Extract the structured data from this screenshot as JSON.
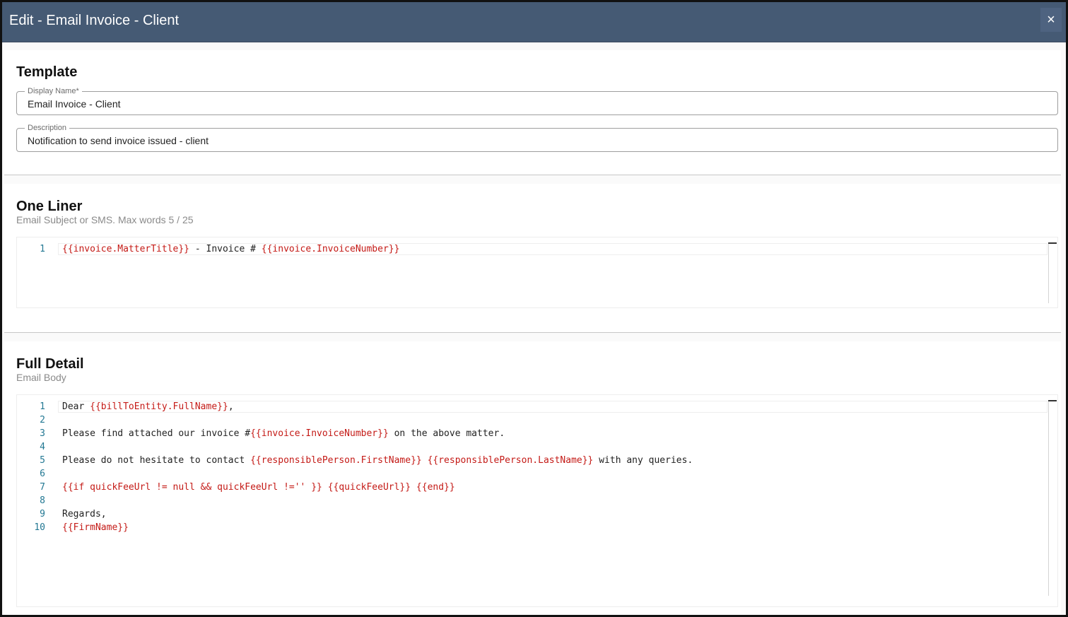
{
  "dialog": {
    "title": "Edit - Email Invoice - Client",
    "close_symbol": "×"
  },
  "template": {
    "heading": "Template",
    "display_name": {
      "label": "Display Name*",
      "value": "Email Invoice - Client"
    },
    "description": {
      "label": "Description",
      "value": "Notification to send invoice issued - client"
    }
  },
  "one_liner": {
    "heading": "One Liner",
    "subheading": "Email Subject or SMS. Max words 5 / 25",
    "lines": [
      {
        "num": "1",
        "tokens": [
          {
            "kind": "v",
            "text": "{{invoice.MatterTitle}}"
          },
          {
            "kind": "t",
            "text": " - Invoice # "
          },
          {
            "kind": "v",
            "text": "{{invoice.InvoiceNumber}}"
          }
        ]
      }
    ]
  },
  "full_detail": {
    "heading": "Full Detail",
    "subheading": "Email Body",
    "lines": [
      {
        "num": "1",
        "tokens": [
          {
            "kind": "t",
            "text": "Dear "
          },
          {
            "kind": "v",
            "text": "{{billToEntity.FullName}}"
          },
          {
            "kind": "t",
            "text": ","
          }
        ]
      },
      {
        "num": "2",
        "tokens": []
      },
      {
        "num": "3",
        "tokens": [
          {
            "kind": "t",
            "text": "Please find attached our invoice #"
          },
          {
            "kind": "v",
            "text": "{{invoice.InvoiceNumber}}"
          },
          {
            "kind": "t",
            "text": " on the above matter."
          }
        ]
      },
      {
        "num": "4",
        "tokens": []
      },
      {
        "num": "5",
        "tokens": [
          {
            "kind": "t",
            "text": "Please do not hesitate to contact "
          },
          {
            "kind": "v",
            "text": "{{responsiblePerson.FirstName}}"
          },
          {
            "kind": "t",
            "text": " "
          },
          {
            "kind": "v",
            "text": "{{responsiblePerson.LastName}}"
          },
          {
            "kind": "t",
            "text": " with any queries."
          }
        ]
      },
      {
        "num": "6",
        "tokens": []
      },
      {
        "num": "7",
        "tokens": [
          {
            "kind": "v",
            "text": "{{if quickFeeUrl != null && quickFeeUrl !='' }}"
          },
          {
            "kind": "t",
            "text": " "
          },
          {
            "kind": "v",
            "text": "{{quickFeeUrl}}"
          },
          {
            "kind": "t",
            "text": " "
          },
          {
            "kind": "v",
            "text": "{{end}}"
          }
        ]
      },
      {
        "num": "8",
        "tokens": []
      },
      {
        "num": "9",
        "tokens": [
          {
            "kind": "t",
            "text": "Regards,"
          }
        ]
      },
      {
        "num": "10",
        "tokens": [
          {
            "kind": "v",
            "text": "{{FirmName}}"
          }
        ]
      }
    ]
  },
  "colors": {
    "titlebar": "#455a74",
    "template_variable": "#c41a16",
    "line_number": "#237893"
  }
}
